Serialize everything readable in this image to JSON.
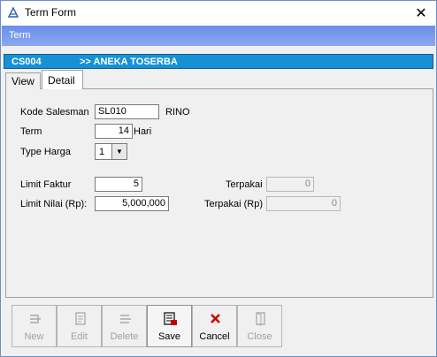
{
  "window": {
    "title": "Term Form",
    "close_label": "✕"
  },
  "header": {
    "label": "Term"
  },
  "customer": {
    "code": "CS004",
    "name": ">>  ANEKA TOSERBA"
  },
  "tabs": {
    "view": "View",
    "detail": "Detail"
  },
  "form": {
    "salesman_label": "Kode Salesman",
    "salesman_value": "SL010",
    "salesman_name": "RINO",
    "term_label": "Term",
    "term_value": "14",
    "term_unit": "Hari",
    "type_harga_label": "Type Harga",
    "type_harga_value": "1",
    "limit_faktur_label": "Limit Faktur",
    "limit_faktur_value": "5",
    "terpakai_label": "Terpakai",
    "terpakai_value": "0",
    "limit_nilai_label": "Limit Nilai (Rp):",
    "limit_nilai_value": "5,000,000",
    "terpakai_rp_label": "Terpakai (Rp)",
    "terpakai_rp_value": "0"
  },
  "toolbar": {
    "new": "New",
    "edit": "Edit",
    "delete": "Delete",
    "save": "Save",
    "cancel": "Cancel",
    "close": "Close"
  }
}
